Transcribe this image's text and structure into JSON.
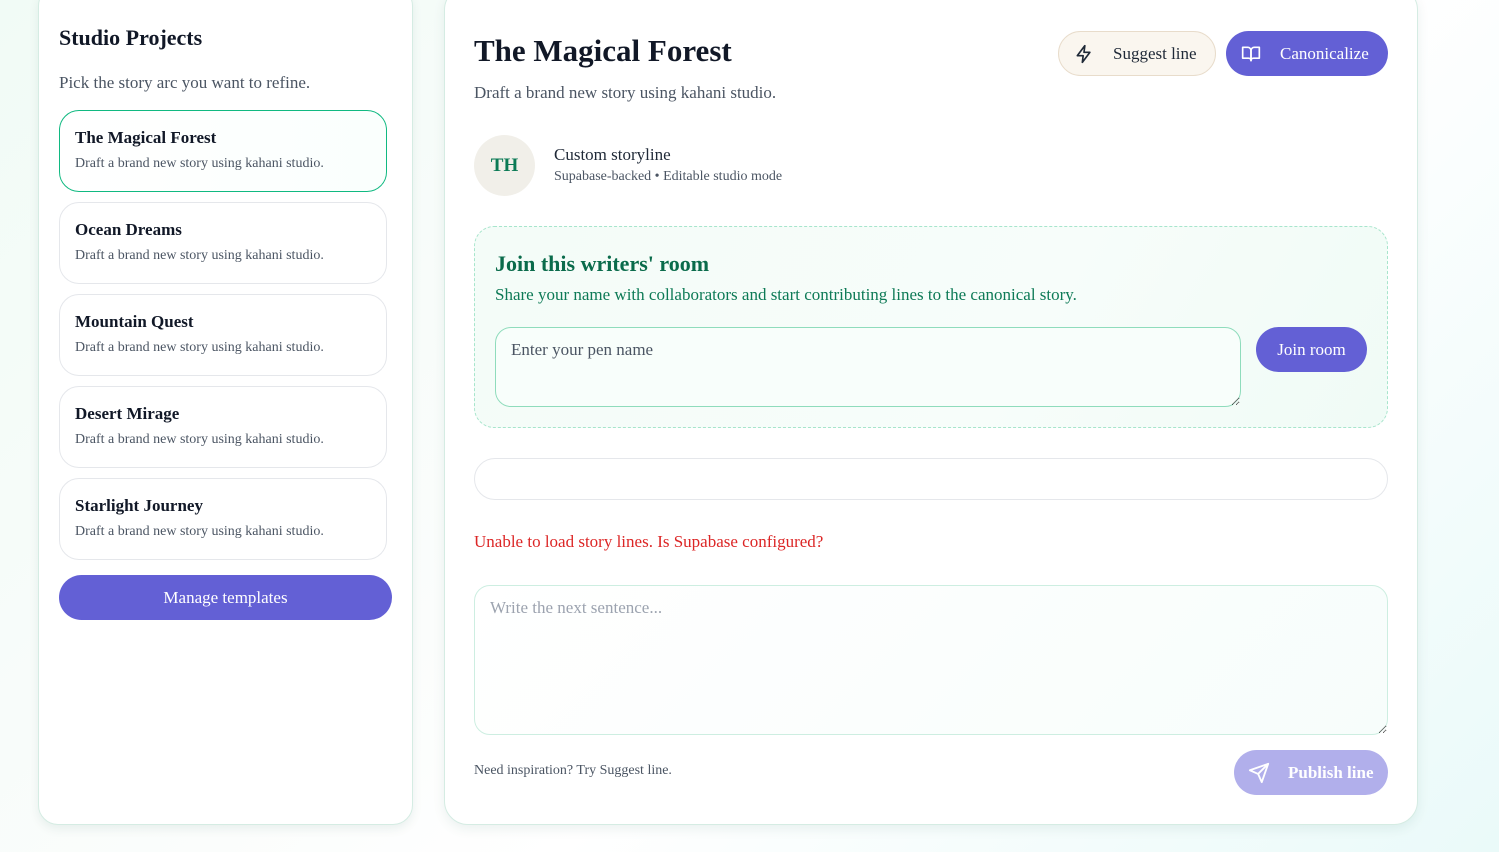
{
  "sidebar": {
    "title": "Studio Projects",
    "subtitle": "Pick the story arc you want to refine.",
    "projects": [
      {
        "name": "The Magical Forest",
        "description": "Draft a brand new story using kahani studio.",
        "active": true
      },
      {
        "name": "Ocean Dreams",
        "description": "Draft a brand new story using kahani studio.",
        "active": false
      },
      {
        "name": "Mountain Quest",
        "description": "Draft a brand new story using kahani studio.",
        "active": false
      },
      {
        "name": "Desert Mirage",
        "description": "Draft a brand new story using kahani studio.",
        "active": false
      },
      {
        "name": "Starlight Journey",
        "description": "Draft a brand new story using kahani studio.",
        "active": false
      }
    ],
    "manage_label": "Manage templates"
  },
  "main": {
    "title": "The Magical Forest",
    "subtitle": "Draft a brand new story using kahani studio.",
    "suggest_label": "Suggest line",
    "suggest_icon": "lightning-icon",
    "canonicalize_label": "Canonicalize",
    "canonicalize_icon": "book-open-icon",
    "avatar_initials": "TH",
    "story_type": "Custom storyline",
    "story_meta": "Supabase-backed • Editable studio mode",
    "join": {
      "title": "Join this writers' room",
      "subtitle": "Share your name with collaborators and start contributing lines to the canonical story.",
      "pen_placeholder": "Enter your pen name",
      "button_label": "Join room"
    },
    "error": "Unable to load story lines. Is Supabase configured?",
    "next_placeholder": "Write the next sentence...",
    "hint": "Need inspiration? Try Suggest line.",
    "publish_label": "Publish line",
    "publish_icon": "send-icon"
  },
  "colors": {
    "accent": "#6360d5",
    "accent_disabled": "#b1afeb",
    "success": "#10b981",
    "error": "#dc2626"
  }
}
